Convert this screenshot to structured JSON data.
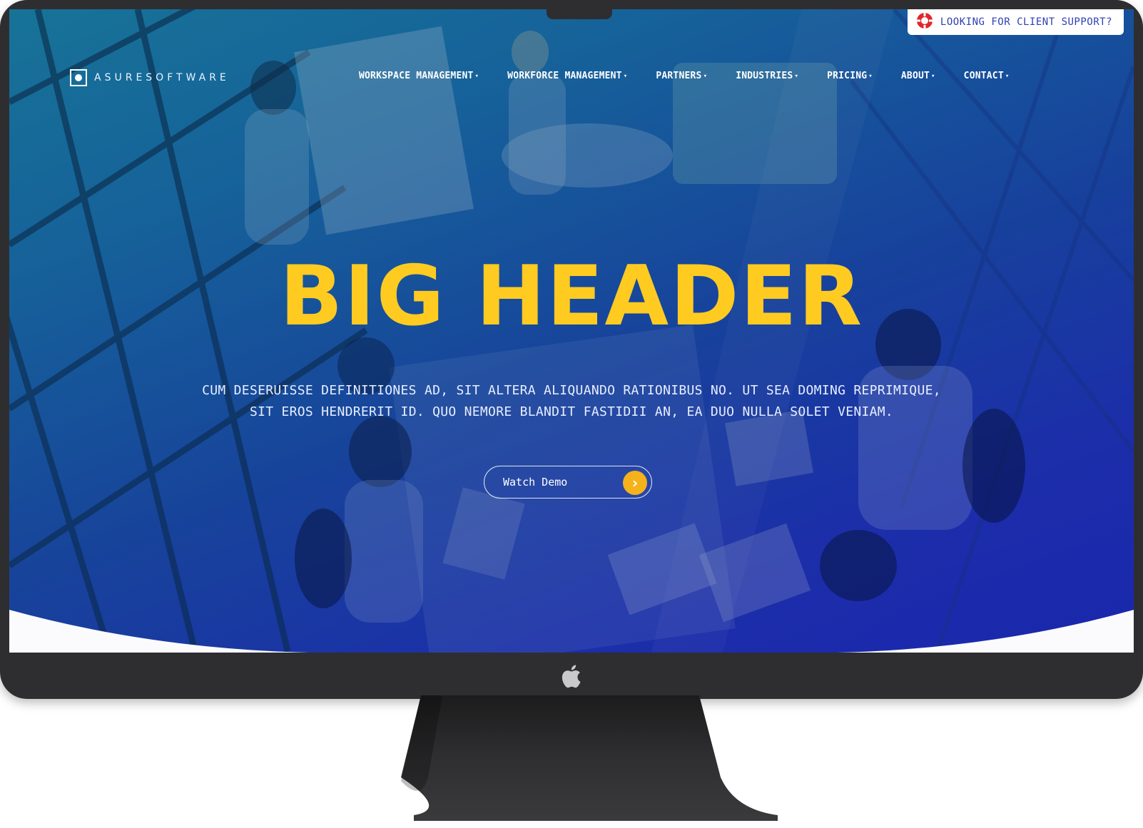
{
  "support": {
    "label": "LOOKING FOR CLIENT SUPPORT?",
    "icon": "lifebuoy-icon"
  },
  "brand": {
    "name": "ASURESOFTWARE"
  },
  "nav": {
    "items": [
      {
        "label": "WORKSPACE MANAGEMENT"
      },
      {
        "label": "WORKFORCE MANAGEMENT"
      },
      {
        "label": "PARTNERS"
      },
      {
        "label": "INDUSTRIES"
      },
      {
        "label": "PRICING"
      },
      {
        "label": "ABOUT"
      },
      {
        "label": "CONTACT"
      }
    ],
    "caret": "▾"
  },
  "hero": {
    "title": "BIG HEADER",
    "subtitle_line1": "CUM DESERUISSE DEFINITIONES AD, SIT ALTERA ALIQUANDO RATIONIBUS NO. UT SEA DOMING REPRIMIQUE,",
    "subtitle_line2": "SIT EROS HENDRERIT ID. QUO NEMORE BLANDIT FASTIDII AN, EA DUO NULLA SOLET VENIAM.",
    "cta_label": "Watch Demo",
    "cta_arrow": "›"
  },
  "colors": {
    "accent_yellow": "#ffcb21",
    "button_orange": "#f5b21a",
    "overlay_blue": "#2536c6",
    "overlay_teal": "#1d8fb4",
    "frame": "#2e2e30"
  }
}
